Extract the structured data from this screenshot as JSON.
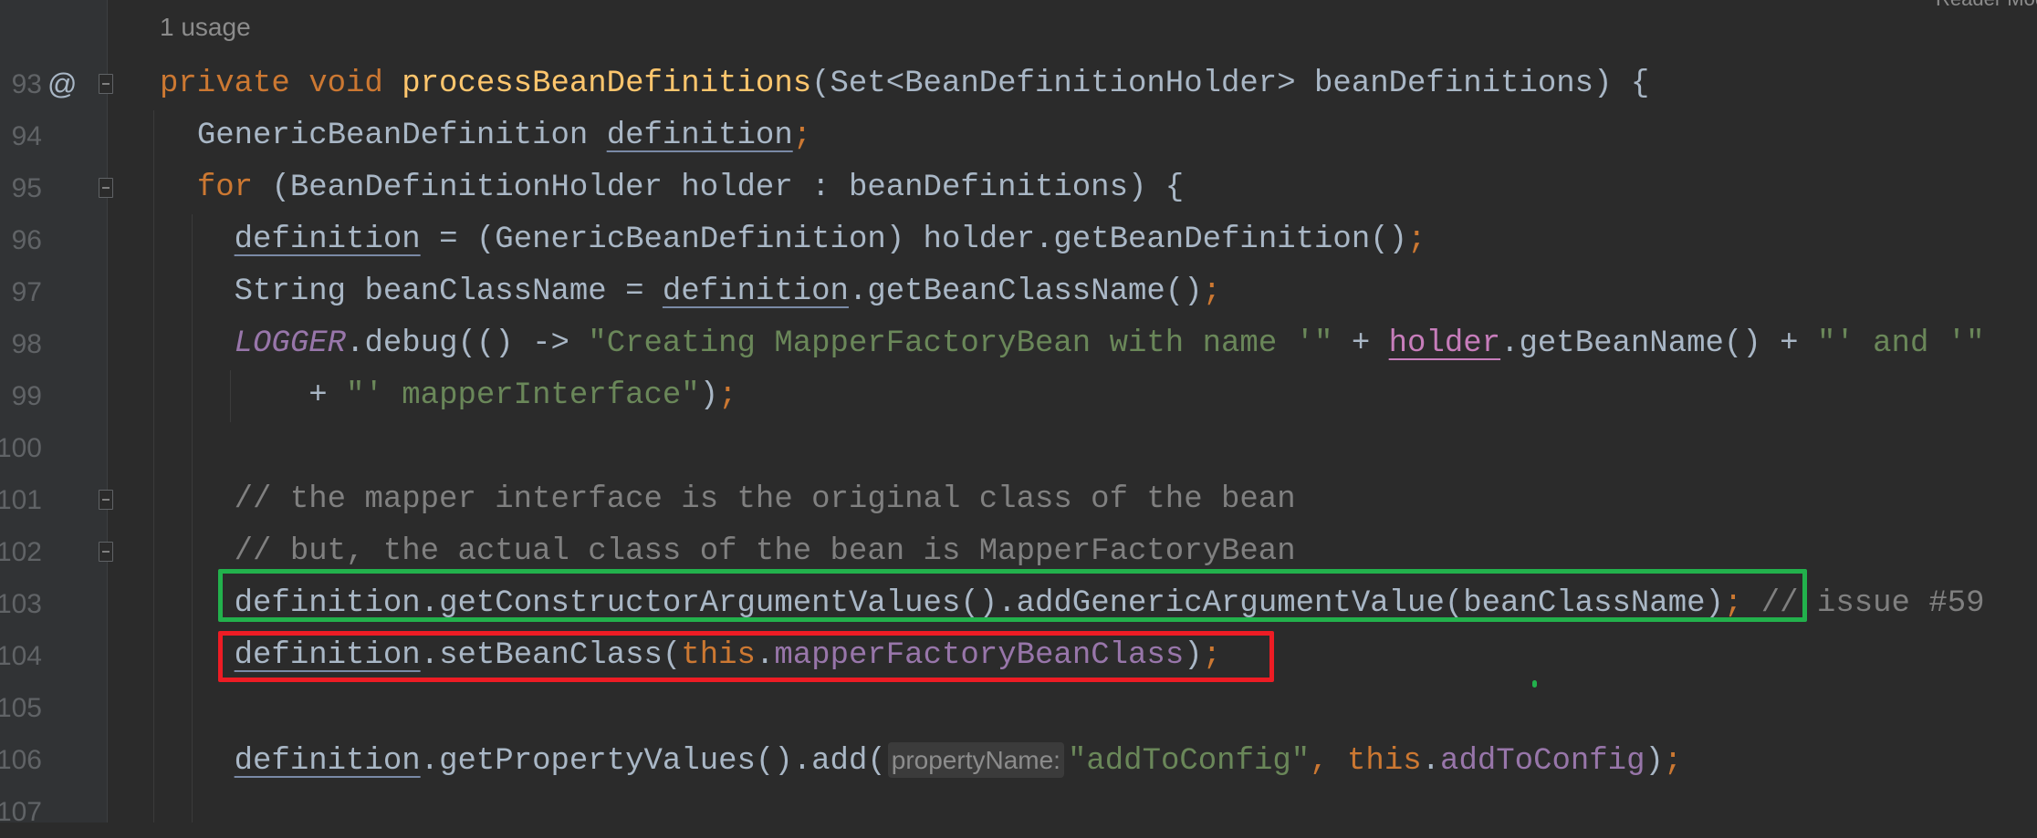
{
  "header": {
    "usages": "1 usage",
    "reader_mode": "Reader Mode"
  },
  "gutter": {
    "override_marker": "@"
  },
  "colors": {
    "green_highlight": "#22b14c",
    "red_highlight": "#ed1c24",
    "background": "#2b2b2b"
  },
  "lines": [
    {
      "number": "93",
      "indent": "",
      "fold": "start",
      "tokens": [
        [
          "private void ",
          "kw"
        ],
        [
          "processBeanDefinitions",
          "fn"
        ],
        [
          "(Set<BeanDefinitionHolder> beanDefinitions) {",
          ""
        ]
      ]
    },
    {
      "number": "94",
      "indent": "  ",
      "tokens": [
        [
          "GenericBeanDefinition ",
          ""
        ],
        [
          "definition",
          "ul"
        ],
        [
          ";",
          "semi"
        ]
      ]
    },
    {
      "number": "95",
      "indent": "  ",
      "fold": "start",
      "tokens": [
        [
          "for ",
          "kw"
        ],
        [
          "(BeanDefinitionHolder holder : beanDefinitions) {",
          ""
        ]
      ]
    },
    {
      "number": "96",
      "indent": "    ",
      "tokens": [
        [
          "definition",
          "ul"
        ],
        [
          " = (GenericBeanDefinition) holder.getBeanDefinition()",
          ""
        ],
        [
          ";",
          "semi"
        ]
      ]
    },
    {
      "number": "97",
      "indent": "    ",
      "tokens": [
        [
          "String beanClassName = ",
          ""
        ],
        [
          "definition",
          "ul"
        ],
        [
          ".getBeanClassName()",
          ""
        ],
        [
          ";",
          "semi"
        ]
      ]
    },
    {
      "number": "98",
      "indent": "    ",
      "tokens": [
        [
          "LOGGER",
          "stat"
        ],
        [
          ".debug(() -> ",
          ""
        ],
        [
          "\"Creating MapperFactoryBean with name '\"",
          "str"
        ],
        [
          " + ",
          ""
        ],
        [
          "holder",
          "ulp"
        ],
        [
          ".getBeanName() + ",
          ""
        ],
        [
          "\"' and '\"",
          "str"
        ]
      ]
    },
    {
      "number": "99",
      "indent": "        ",
      "tokens": [
        [
          "+ ",
          ""
        ],
        [
          "\"' mapperInterface\"",
          "str"
        ],
        [
          ")",
          ""
        ],
        [
          ";",
          "semi"
        ]
      ]
    },
    {
      "number": "100",
      "indent": "",
      "tokens": []
    },
    {
      "number": "101",
      "indent": "    ",
      "fold": "start",
      "tokens": [
        [
          "// the mapper interface is the original class of the bean",
          "cm"
        ]
      ]
    },
    {
      "number": "102",
      "indent": "    ",
      "fold": "end",
      "tokens": [
        [
          "// but, the actual class of the bean is MapperFactoryBean",
          "cm"
        ]
      ]
    },
    {
      "number": "103",
      "indent": "    ",
      "highlight": "green",
      "tokens": [
        [
          "definition",
          "ul"
        ],
        [
          ".getConstructorArgumentValues().addGenericArgumentValue(beanClassName)",
          ""
        ],
        [
          ";",
          "semi"
        ],
        [
          " // issue #59",
          "cm"
        ]
      ]
    },
    {
      "number": "104",
      "indent": "    ",
      "highlight": "red",
      "tokens": [
        [
          "definition",
          "ul"
        ],
        [
          ".setBeanClass(",
          ""
        ],
        [
          "this",
          "kw"
        ],
        [
          ".",
          ""
        ],
        [
          "mapperFactoryBeanClass",
          "fld"
        ],
        [
          ")",
          ""
        ],
        [
          ";",
          "semi"
        ]
      ]
    },
    {
      "number": "105",
      "indent": "",
      "tokens": []
    },
    {
      "number": "106",
      "indent": "    ",
      "tokens": [
        [
          "definition",
          "ul"
        ],
        [
          ".getPropertyValues().add(",
          ""
        ],
        [
          "propertyName:",
          "hint"
        ],
        [
          "\"addToConfig\"",
          "str"
        ],
        [
          ", ",
          "semi"
        ],
        [
          "this",
          "kw"
        ],
        [
          ".",
          ""
        ],
        [
          "addToConfig",
          "fld"
        ],
        [
          ")",
          ""
        ],
        [
          ";",
          "semi"
        ]
      ]
    },
    {
      "number": "107",
      "indent": "",
      "tokens": []
    }
  ]
}
